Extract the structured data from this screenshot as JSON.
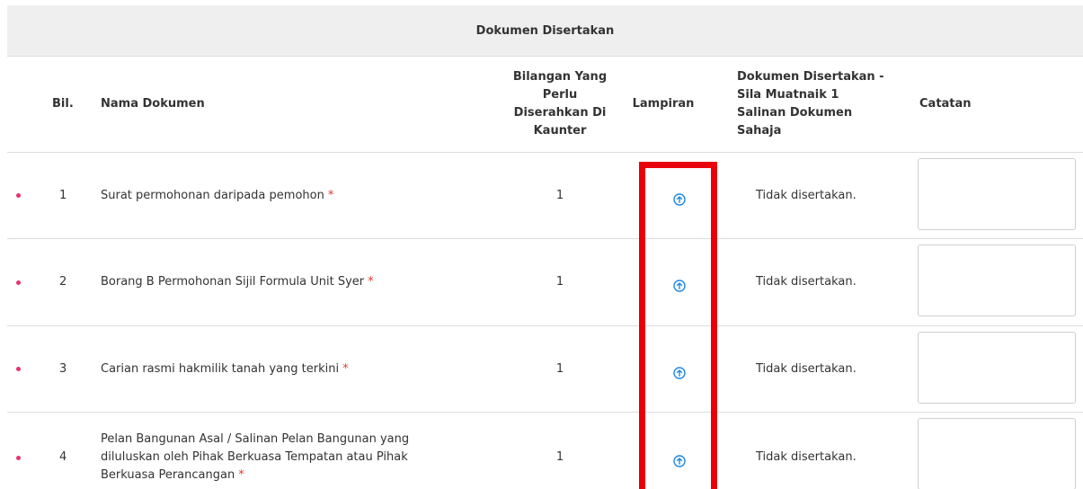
{
  "section": {
    "title": "Dokumen Disertakan"
  },
  "headers": {
    "bil": "Bil.",
    "nama": "Nama Dokumen",
    "bilangan": "Bilangan Yang Perlu Diserahkan Di Kaunter",
    "lampiran": "Lampiran",
    "disertakan": "Dokumen Disertakan - Sila Muatnaik 1 Salinan Dokumen Sahaja",
    "catatan": "Catatan"
  },
  "rows": [
    {
      "bil": "1",
      "nama": "Surat permohonan daripada pemohon",
      "required_mark": "*",
      "bilangan": "1",
      "attachment_icon": "upload-icon",
      "status": "Tidak disertakan.",
      "note": ""
    },
    {
      "bil": "2",
      "nama": "Borang B Permohonan Sijil Formula Unit Syer",
      "required_mark": "*",
      "bilangan": "1",
      "attachment_icon": "upload-icon",
      "status": "Tidak disertakan.",
      "note": ""
    },
    {
      "bil": "3",
      "nama": "Carian rasmi hakmilik tanah yang terkini",
      "required_mark": "*",
      "bilangan": "1",
      "attachment_icon": "upload-icon",
      "status": "Tidak disertakan.",
      "note": ""
    },
    {
      "bil": "4",
      "nama": "Pelan Bangunan Asal / Salinan Pelan Bangunan yang diluluskan oleh Pihak Berkuasa Tempatan atau Pihak Berkuasa Perancangan",
      "required_mark": "*",
      "bilangan": "1",
      "attachment_icon": "upload-icon",
      "status": "Tidak disertakan.",
      "note": ""
    }
  ],
  "colors": {
    "header_bg": "#efefef",
    "bullet": "#e8336e",
    "required": "#e53935",
    "upload_icon": "#1e88e5",
    "highlight_border": "#e8000b"
  }
}
